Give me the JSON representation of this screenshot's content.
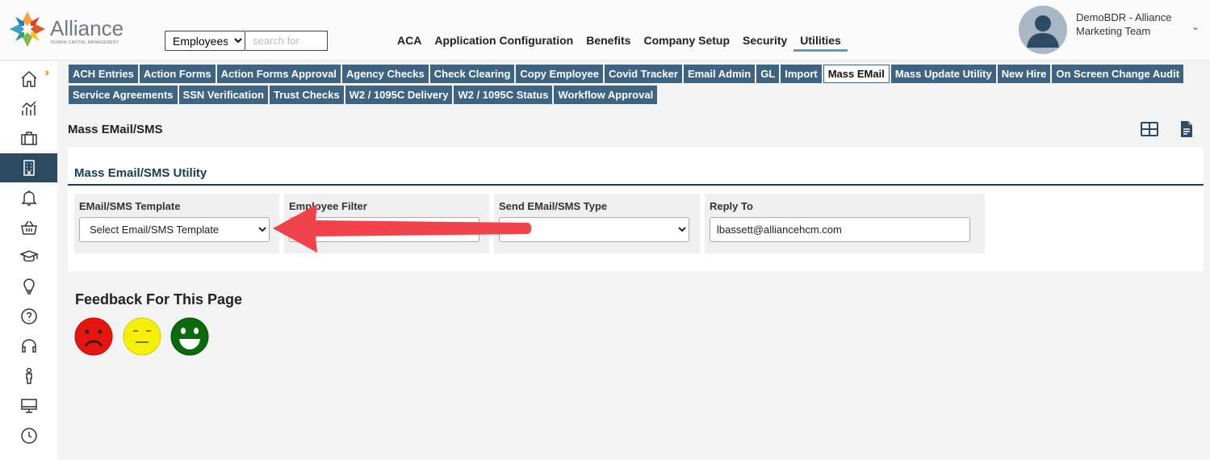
{
  "brand": {
    "name": "Alliance",
    "tagline": "HUMAN CAPITAL MANAGEMENT"
  },
  "search": {
    "scope": "Employees",
    "scope_options": [
      "Employees"
    ],
    "placeholder": "search for"
  },
  "topnav": [
    {
      "label": "ACA",
      "active": false
    },
    {
      "label": "Application Configuration",
      "active": false
    },
    {
      "label": "Benefits",
      "active": false
    },
    {
      "label": "Company Setup",
      "active": false
    },
    {
      "label": "Security",
      "active": false
    },
    {
      "label": "Utilities",
      "active": true
    }
  ],
  "user": {
    "line1": "DemoBDR - Alliance",
    "line2": "Marketing Team"
  },
  "sidebar": {
    "items": [
      {
        "icon": "home-icon"
      },
      {
        "icon": "analytics-icon"
      },
      {
        "icon": "briefcase-icon"
      },
      {
        "icon": "building-icon",
        "active": true
      },
      {
        "icon": "bell-icon"
      },
      {
        "icon": "basket-icon"
      },
      {
        "icon": "graduation-cap-icon"
      },
      {
        "icon": "lightbulb-icon"
      },
      {
        "icon": "help-icon"
      },
      {
        "icon": "headset-icon"
      },
      {
        "icon": "person-icon"
      },
      {
        "icon": "monitor-icon"
      },
      {
        "icon": "clock-icon"
      }
    ]
  },
  "tabs": {
    "row1": [
      "ACH Entries",
      "Action Forms",
      "Action Forms Approval",
      "Agency Checks",
      "Check Clearing",
      "Copy Employee",
      "Covid Tracker",
      "Email Admin",
      "GL",
      "Import",
      "Mass EMail",
      "Mass Update Utility",
      "New Hire",
      "On Screen Change Audit"
    ],
    "row2": [
      "Service Agreements",
      "SSN Verification",
      "Trust Checks",
      "W2 / 1095C Delivery",
      "W2 / 1095C Status",
      "Workflow Approval"
    ],
    "active": "Mass EMail"
  },
  "page": {
    "title": "Mass EMail/SMS"
  },
  "panel": {
    "title": "Mass Email/SMS Utility",
    "fields": {
      "template": {
        "label": "EMail/SMS Template",
        "value": "Select Email/SMS Template"
      },
      "filter": {
        "label": "Employee Filter",
        "value": ""
      },
      "send_type": {
        "label": "Send EMail/SMS Type",
        "value": ""
      },
      "reply_to": {
        "label": "Reply To",
        "value": "lbassett@alliancehcm.com"
      }
    }
  },
  "feedback": {
    "title": "Feedback For This Page"
  },
  "colors": {
    "nav_dark": "#2d4a63",
    "tab_bg": "#3f6481",
    "arrow": "#f0434b",
    "sad": "#e8140f",
    "neutral": "#f5f000",
    "happy": "#0b6a0b"
  }
}
